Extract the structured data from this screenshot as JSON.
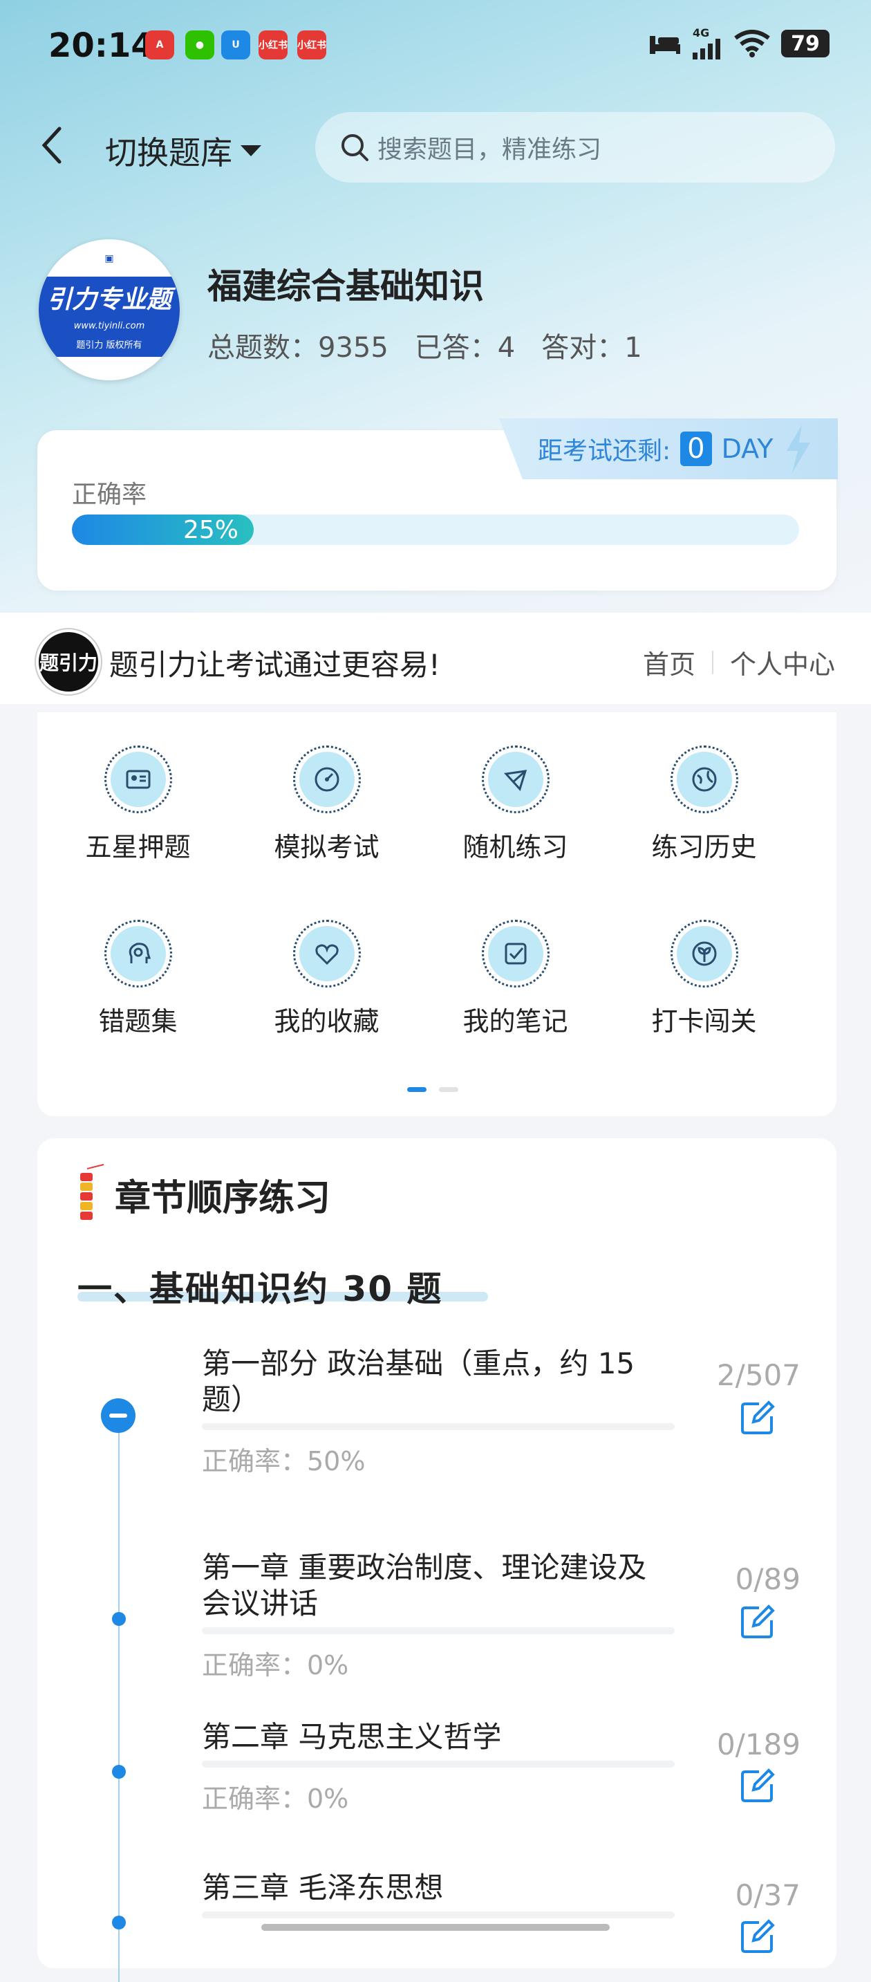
{
  "status_bar": {
    "time": "20:14",
    "app_icons": [
      {
        "name": "app-a-icon",
        "text": "A",
        "color": "#e53935"
      },
      {
        "name": "wechat-icon",
        "text": "●",
        "color": "#2dc100"
      },
      {
        "name": "app-u-icon",
        "text": "U",
        "color": "#1e88e5"
      },
      {
        "name": "xiaohongshu-icon",
        "text": "小红书",
        "color": "#e53935"
      },
      {
        "name": "xiaohongshu2-icon",
        "text": "小红书",
        "color": "#e53935"
      }
    ],
    "network": "4G",
    "battery": "79"
  },
  "header": {
    "switch_label": "切换题库",
    "search_placeholder": "搜索题目，精准练习"
  },
  "book": {
    "logo_text": "引力专业题",
    "logo_url": "www.tiyinli.com",
    "logo_owner": "题引力 版权所有",
    "title": "福建综合基础知识",
    "total": "总题数：9355",
    "answered": "已答：4",
    "correct": "答对：1"
  },
  "accuracy": {
    "label": "正确率",
    "value": 0.25,
    "value_text": "25%",
    "countdown_label": "距考试还剩:",
    "countdown_days": "0",
    "countdown_unit": "DAY"
  },
  "banner": {
    "logo_text": "题引力",
    "slogan": "题引力让考试通过更容易!",
    "link_home": "首页",
    "link_profile": "个人中心"
  },
  "grid": [
    {
      "label": "五星押题",
      "icon": "id-card-icon"
    },
    {
      "label": "模拟考试",
      "icon": "gauge-icon"
    },
    {
      "label": "随机练习",
      "icon": "network-icon"
    },
    {
      "label": "练习历史",
      "icon": "globe-icon"
    },
    {
      "label": "错题集",
      "icon": "head-icon"
    },
    {
      "label": "我的收藏",
      "icon": "heart-icon"
    },
    {
      "label": "我的笔记",
      "icon": "note-check-icon"
    },
    {
      "label": "打卡闯关",
      "icon": "sprout-icon"
    }
  ],
  "chapters_section": {
    "title": "章节顺序练习",
    "section_title": "一、基础知识约 30 题",
    "items": [
      {
        "name": "第一部分 政治基础（重点，约 15 题）",
        "rate": "正确率：50%",
        "count": "2/507",
        "progress": 0.004
      },
      {
        "name": "第一章 重要政治制度、理论建设及会议讲话",
        "rate": "正确率：0%",
        "count": "0/89",
        "progress": 0
      },
      {
        "name": "第二章 马克思主义哲学",
        "rate": "正确率：0%",
        "count": "0/189",
        "progress": 0
      },
      {
        "name": "第三章 毛泽东思想",
        "rate": "",
        "count": "0/37",
        "progress": 0
      }
    ]
  },
  "colors": {
    "accent": "#1e88e5",
    "teal": "#29c0c0"
  }
}
